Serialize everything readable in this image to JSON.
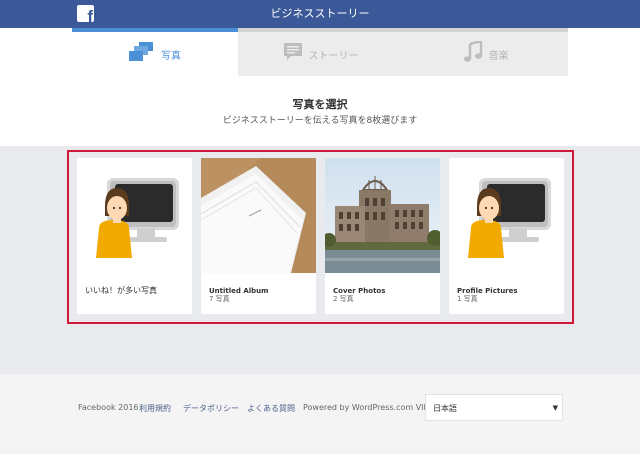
{
  "topbar": {
    "title": "ビジネスストーリー",
    "logo_letter": "f"
  },
  "tabs": [
    {
      "label": "写真",
      "icon": "photos-icon",
      "active": true
    },
    {
      "label": "ストーリー",
      "icon": "story-icon",
      "active": false
    },
    {
      "label": "音楽",
      "icon": "music-icon",
      "active": false
    }
  ],
  "heading": {
    "title": "写真を選択",
    "subtitle": "ビジネスストーリーを伝える写真を8枚選びます"
  },
  "albums": [
    {
      "name": "いいね！が多い写真",
      "count": ""
    },
    {
      "name": "Untitled Album",
      "count": "7 写真"
    },
    {
      "name": "Cover Photos",
      "count": "2 写真"
    },
    {
      "name": "Profile Pictures",
      "count": "1 写真"
    }
  ],
  "footer": {
    "copyright": "Facebook 2016",
    "terms": "利用規約",
    "data_policy": "データポリシー",
    "faq": "よくある質問",
    "powered": "Powered by WordPress.com VIP",
    "language": "日本語"
  },
  "colors": {
    "brand": "#3b5998",
    "accent": "#4a90d9",
    "highlight": "#d0183a"
  }
}
